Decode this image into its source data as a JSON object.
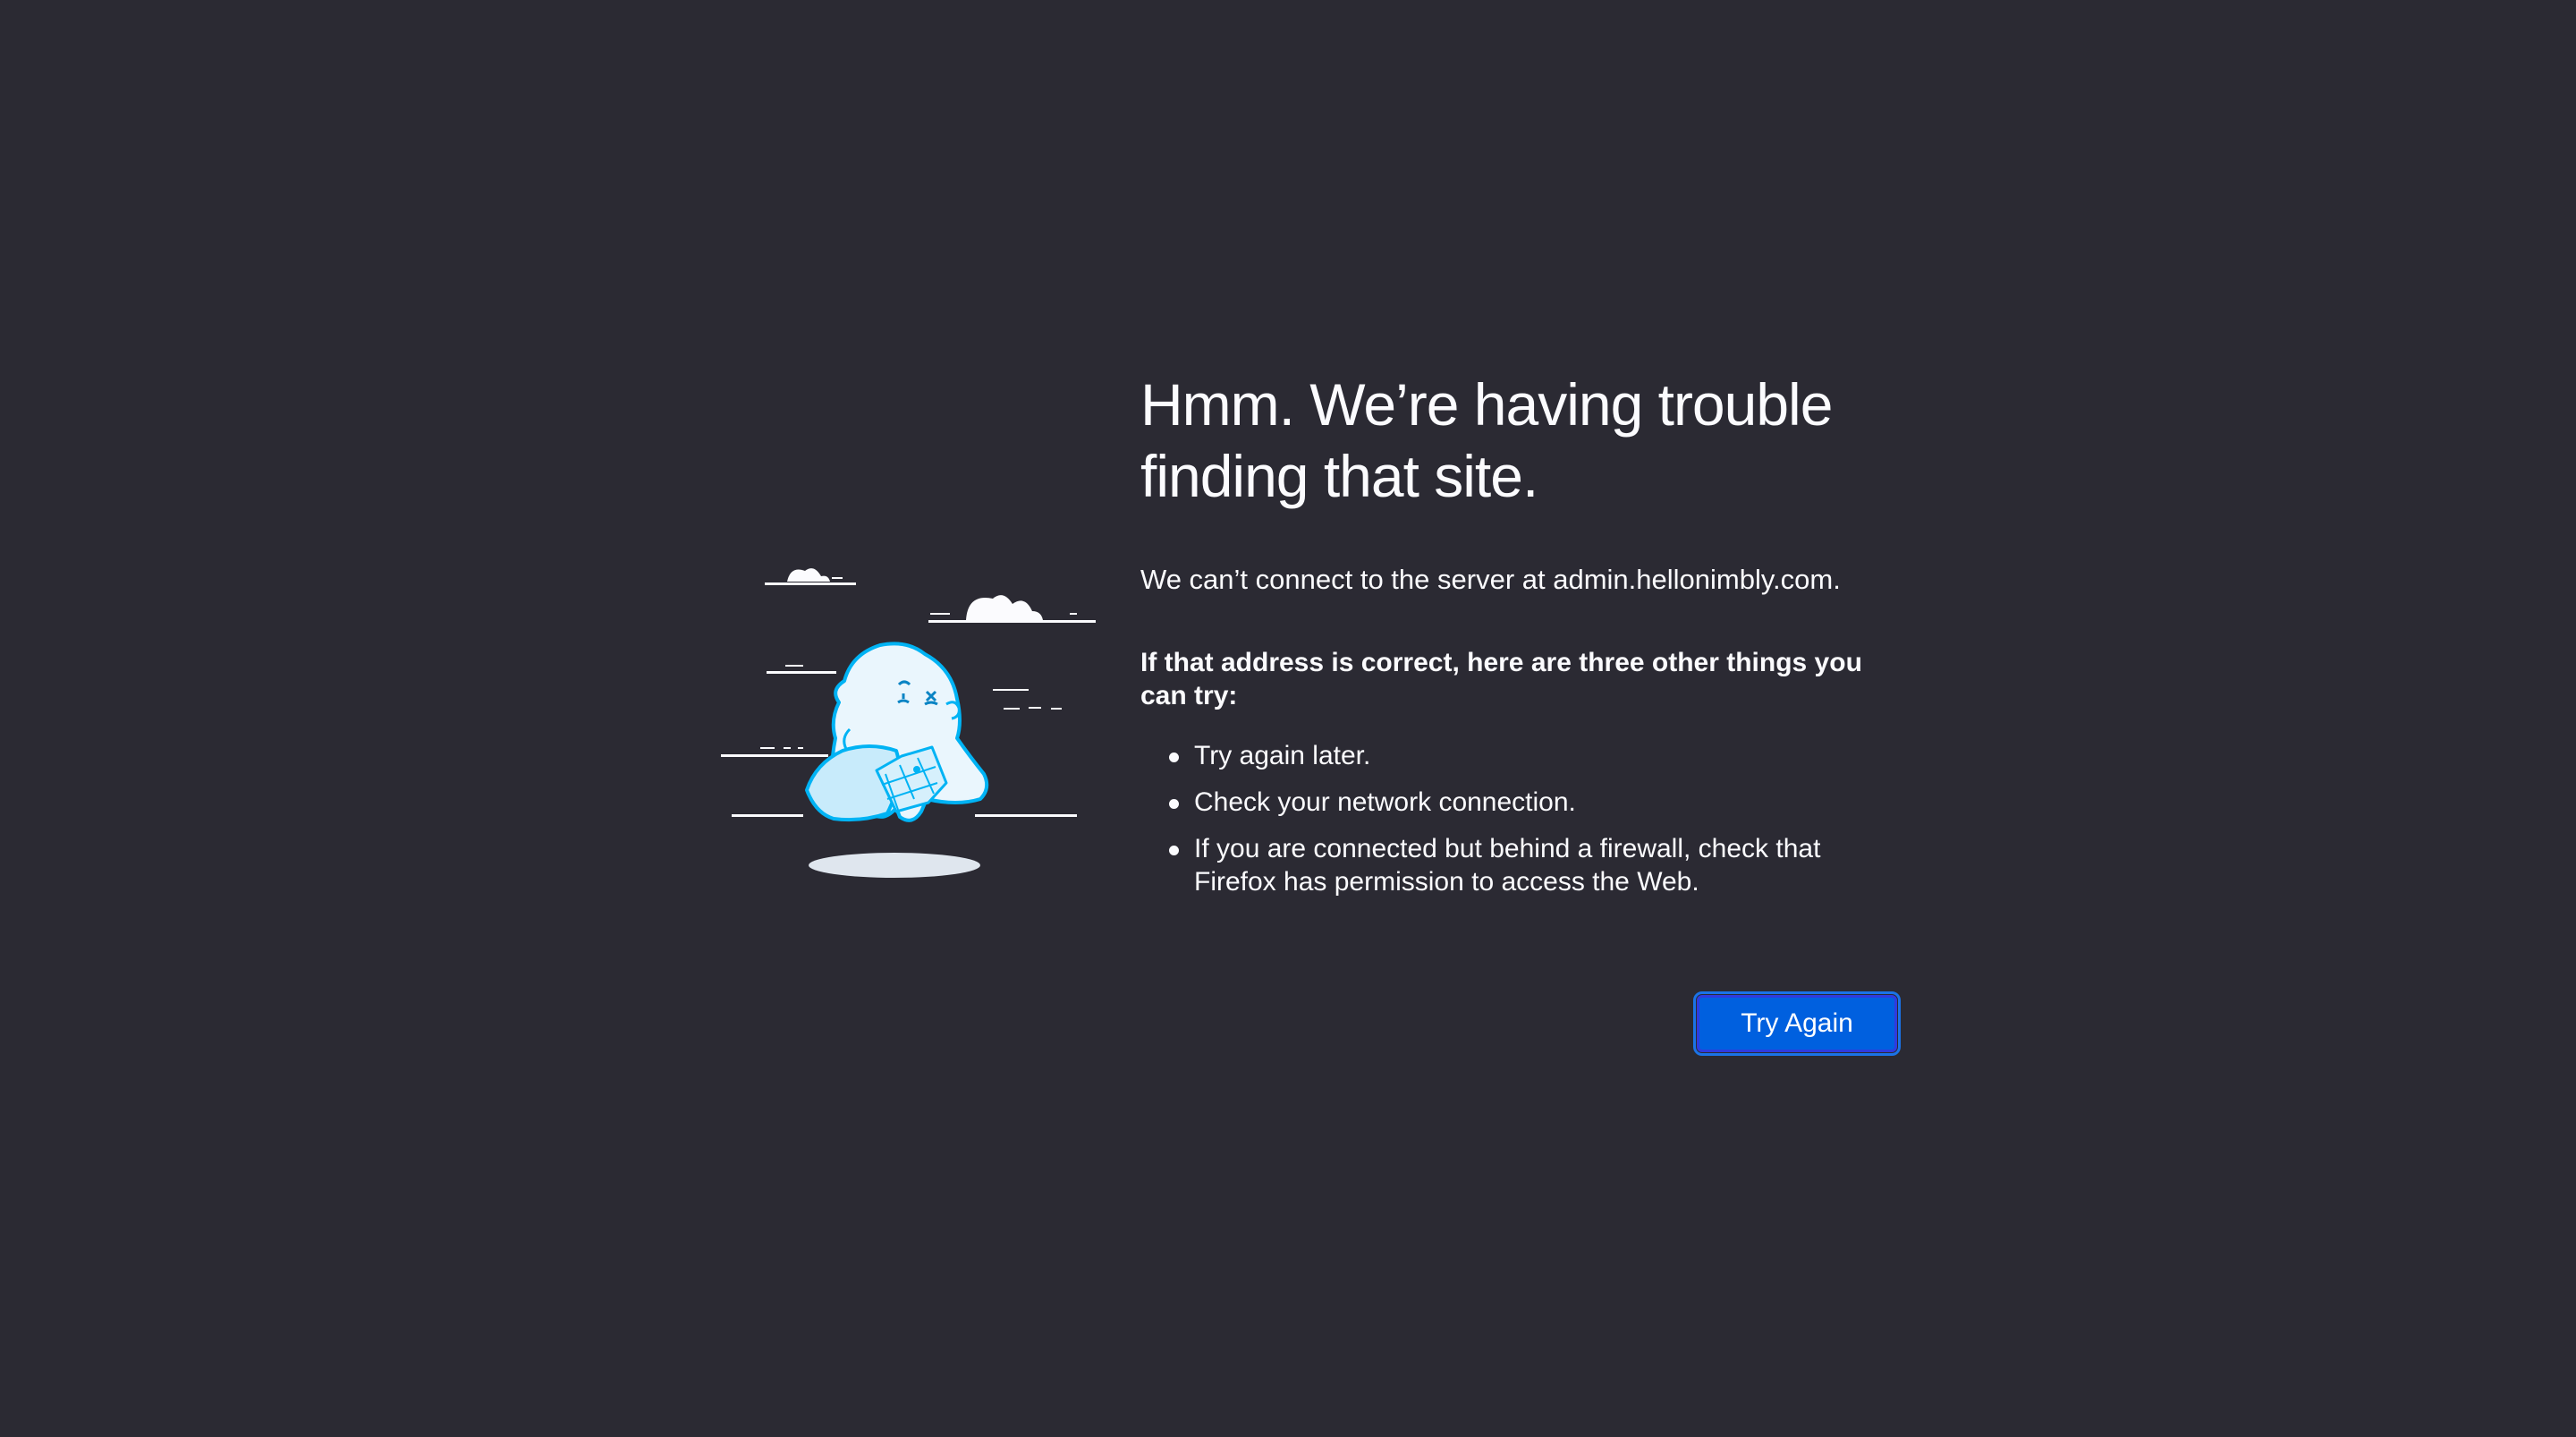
{
  "error": {
    "title": "Hmm. We’re having trouble finding that site.",
    "description": "We can’t connect to the server at admin.hellonimbly.com.",
    "suggestions_title": "If that address is correct, here are three other things you can try:",
    "suggestions": [
      "Try again later.",
      "Check your network connection.",
      "If you are connected but behind a firewall, check that Firefox has permission to access the Web."
    ]
  },
  "actions": {
    "try_again_label": "Try Again"
  },
  "icons": {
    "illustration": "lost-dino-with-map-illustration"
  },
  "colors": {
    "background": "#2b2a33",
    "text": "#fbfbfe",
    "button": "#0060df",
    "illustration_accent": "#00b3f4"
  }
}
